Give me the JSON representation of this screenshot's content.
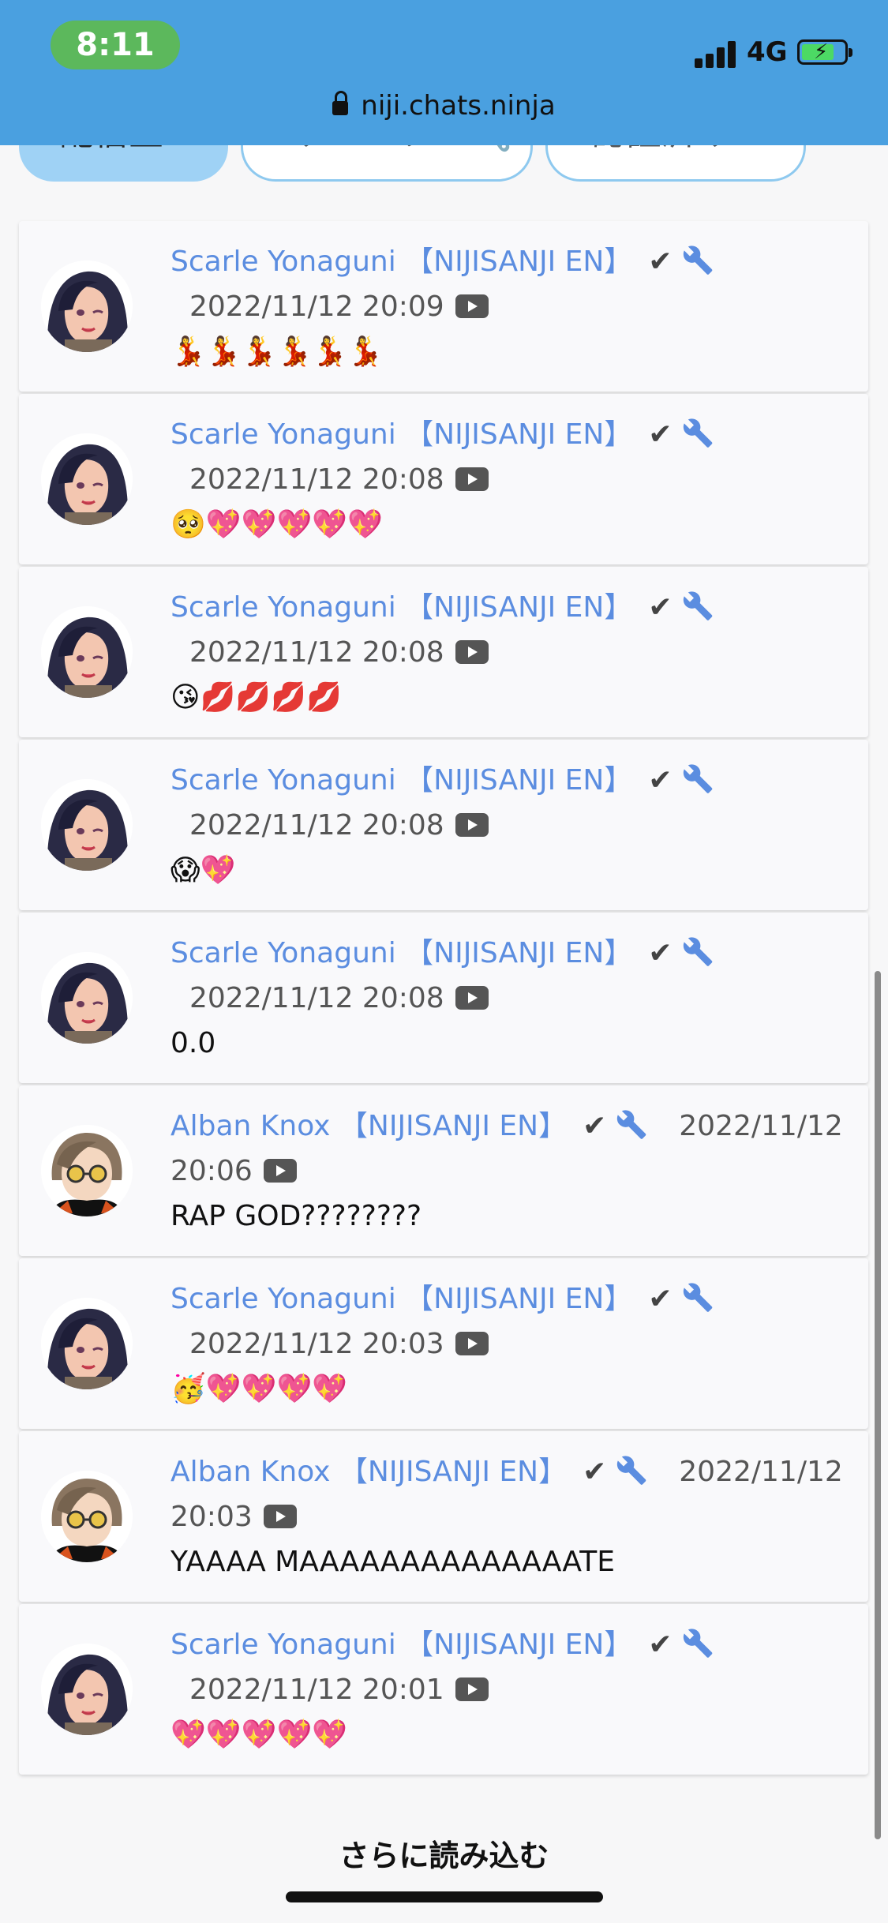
{
  "status_bar": {
    "time": "8:11",
    "network": "4G",
    "url": "niji.chats.ninja"
  },
  "filters": [
    {
      "label": "配信主⚡",
      "active": true
    },
    {
      "label": "モデレーター🔧",
      "active": false
    },
    {
      "label": "認証済み✔",
      "active": false
    }
  ],
  "messages": [
    {
      "author": "Scarle Yonaguni 【NIJISANJI EN】",
      "timestamp": "2022/11/12 20:09",
      "text": "💃💃💃💃💃💃",
      "avatar": "scarle"
    },
    {
      "author": "Scarle Yonaguni 【NIJISANJI EN】",
      "timestamp": "2022/11/12 20:08",
      "text": "🥺💖💖💖💖💖",
      "avatar": "scarle"
    },
    {
      "author": "Scarle Yonaguni 【NIJISANJI EN】",
      "timestamp": "2022/11/12 20:08",
      "text": "😘💋💋💋💋",
      "avatar": "scarle"
    },
    {
      "author": "Scarle Yonaguni 【NIJISANJI EN】",
      "timestamp": "2022/11/12 20:08",
      "text": "😱💖",
      "avatar": "scarle"
    },
    {
      "author": "Scarle Yonaguni 【NIJISANJI EN】",
      "timestamp": "2022/11/12 20:08",
      "text": "0.0",
      "avatar": "scarle"
    },
    {
      "author": "Alban Knox 【NIJISANJI EN】",
      "timestamp_part1": "2022/11/12",
      "timestamp_part2": "20:06",
      "text": "RAP GOD????????",
      "avatar": "alban"
    },
    {
      "author": "Scarle Yonaguni 【NIJISANJI EN】",
      "timestamp": "2022/11/12 20:03",
      "text": "🥳💖💖💖💖",
      "avatar": "scarle"
    },
    {
      "author": "Alban Knox 【NIJISANJI EN】",
      "timestamp_part1": "2022/11/12",
      "timestamp_part2": "20:03",
      "text": "YAAAA MAAAAAAAAAAAAAATE",
      "avatar": "alban"
    },
    {
      "author": "Scarle Yonaguni 【NIJISANJI EN】",
      "timestamp": "2022/11/12 20:01",
      "text": "💖💖💖💖💖",
      "avatar": "scarle"
    }
  ],
  "load_more_label": "さらに読み込む",
  "colors": {
    "status_bar_bg": "#4aa0e0",
    "author_link": "#5b8de0",
    "active_pill": "#9fd2f5"
  },
  "icons": [
    "check-icon",
    "wrench-icon",
    "youtube-icon",
    "lock-icon",
    "signal-icon",
    "battery-icon"
  ]
}
